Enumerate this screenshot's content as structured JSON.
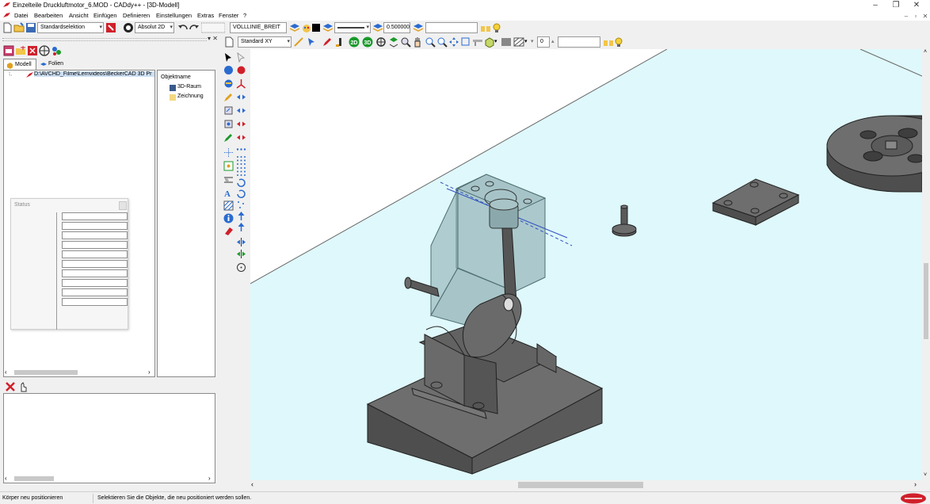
{
  "window": {
    "title": "Einzelteile Druckluftmotor_6.MOD  -  CADdy++ - [3D-Modell]",
    "controls": {
      "minimize": "–",
      "maximize": "❐",
      "close": "✕"
    }
  },
  "menu": {
    "items": [
      "Datei",
      "Bearbeiten",
      "Ansicht",
      "Einfügen",
      "Definieren",
      "Einstellungen",
      "Extras",
      "Fenster",
      "?"
    ],
    "mdi": {
      "minimize": "–",
      "restore": "▫",
      "close": "✕"
    }
  },
  "toolbar1": {
    "selection_mode": "Standardselektion",
    "coord_mode": "Absolut 2D",
    "line_type": "VOLLLINIE_BREIT",
    "line_width": "0.500000",
    "text_field": ""
  },
  "toolbar2": {
    "view": "Standard XY",
    "btn_2d": "2D",
    "btn_3d": "3D",
    "spin_value": "0",
    "text_field": ""
  },
  "left_panel": {
    "pin": "▾ ✕",
    "tabs": [
      "Modell",
      "Folien"
    ],
    "tree_item": "D:\\AVCHD_Filme\\Lernvideos\\BeckerCAD 3D Pr",
    "obj_header": "Objektname",
    "obj_items": [
      "3D-Raum",
      "Zeichnung"
    ],
    "status_title": "Status"
  },
  "statusbar": {
    "left": "Körper neu positionieren",
    "message": "Selektieren Sie die Objekte, die neu positioniert werden sollen."
  },
  "colors": {
    "bg_cyan": "#dff8fb",
    "part_gray": "#5d5d5d",
    "glass": "#7fa3a8",
    "accent_red": "#d0202a"
  }
}
